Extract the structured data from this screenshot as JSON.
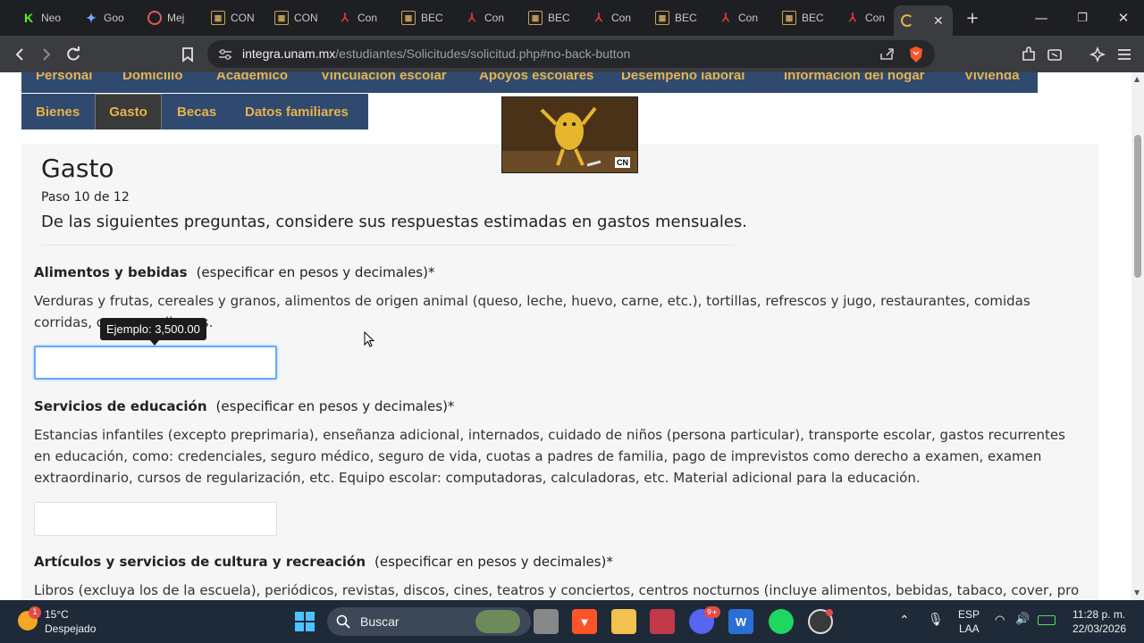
{
  "browser": {
    "tabs": [
      {
        "label": "Neo",
        "icon": "kick-icon",
        "color": "#53fc18"
      },
      {
        "label": "Goo",
        "icon": "gemini-icon",
        "color": "#7aa7ff"
      },
      {
        "label": "Mej",
        "icon": "target-icon",
        "color": "#e05a5a"
      },
      {
        "label": "CON",
        "icon": "unam-icon",
        "color": "#c9a05a"
      },
      {
        "label": "CON",
        "icon": "unam-icon",
        "color": "#c9a05a"
      },
      {
        "label": "Con",
        "icon": "pdf-icon",
        "color": "#e0382f"
      },
      {
        "label": "BEC",
        "icon": "unam-icon",
        "color": "#c9a05a"
      },
      {
        "label": "Con",
        "icon": "pdf-icon",
        "color": "#e0382f"
      },
      {
        "label": "BEC",
        "icon": "unam-icon",
        "color": "#c9a05a"
      },
      {
        "label": "Con",
        "icon": "pdf-icon",
        "color": "#e0382f"
      },
      {
        "label": "BEC",
        "icon": "unam-icon",
        "color": "#c9a05a"
      },
      {
        "label": "Con",
        "icon": "pdf-icon",
        "color": "#e0382f"
      },
      {
        "label": "BEC",
        "icon": "unam-icon",
        "color": "#c9a05a"
      },
      {
        "label": "Con",
        "icon": "pdf-icon",
        "color": "#e0382f"
      }
    ],
    "url_domain": "integra.unam.mx",
    "url_path": "/estudiantes/Solicitudes/solicitud.php#no-back-button"
  },
  "nav": {
    "row1": [
      "Personal",
      "Domicilio",
      "Académico",
      "Vinculación escolar",
      "Apoyos escolares",
      "Desempeño laboral",
      "Información del hogar",
      "Vivienda"
    ],
    "row2": [
      "Bienes",
      "Gasto",
      "Becas",
      "Datos familiares"
    ],
    "active": "Gasto"
  },
  "form": {
    "title": "Gasto",
    "step": "Paso 10 de 12",
    "subtitle": "De las siguientes preguntas, considere sus respuestas estimadas en gastos mensuales.",
    "tooltip": "Ejemplo: 3,500.00",
    "questions": [
      {
        "label": "Alimentos y bebidas",
        "note": "(especificar en pesos y decimales)*",
        "desc": "Verduras y frutas, cereales y granos, alimentos de origen animal (queso, leche, huevo, carne, etc.), tortillas, refrescos y jugo, restaurantes, comidas corridas, cerveza y licores.",
        "value": ""
      },
      {
        "label": "Servicios de educación",
        "note": "(especificar en pesos y decimales)*",
        "desc": "Estancias infantiles (excepto preprimaria), enseñanza adicional, internados, cuidado de niños (persona particular), transporte escolar, gastos recurrentes en educación, como: credenciales, seguro médico, seguro de vida, cuotas a padres de familia, pago de imprevistos como derecho a examen, examen extraordinario, cursos de regularización, etc. Equipo escolar: computadoras, calculadoras, etc. Material adicional para la educación.",
        "value": ""
      },
      {
        "label": "Artículos y servicios de cultura y recreación",
        "note": "(especificar en pesos y decimales)*",
        "desc": "Libros (excluya los de la escuela), periódicos, revistas, discos, cines, teatros y conciertos, centros nocturnos (incluye alimentos, bebidas, tabaco, cover, propinas, etc.),"
      }
    ]
  },
  "video": {
    "badge": "CN"
  },
  "taskbar": {
    "weather_temp": "15°C",
    "weather_desc": "Despejado",
    "weather_badge": "1",
    "search_placeholder": "Buscar",
    "lang_top": "ESP",
    "lang_bottom": "LAA",
    "time": "11:28 p. m.",
    "date": "22/03/2026",
    "discord_badge": "9+"
  },
  "colors": {
    "nav_bg": "#2f4a6e",
    "nav_text": "#e8b24a",
    "taskbar_bg": "#1f2a38"
  }
}
